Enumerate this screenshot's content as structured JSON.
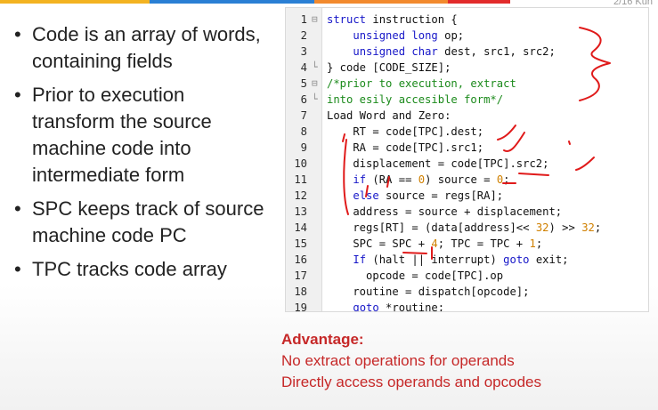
{
  "colors": {
    "bar_yellow": "#f3b321",
    "bar_blue": "#2a7fd4",
    "bar_orange": "#f28a2e",
    "bar_red": "#e22b2b",
    "keyword": "#1616c8",
    "comment": "#1b8a1b",
    "number": "#d08000",
    "advantage": "#c62828",
    "annotation": "#e01a1a"
  },
  "corner_text": "2/16 Kun",
  "bullets": [
    {
      "text": "Code is an array of words, containing fields"
    },
    {
      "text": "Prior to execution transform the source machine code into intermediate form"
    },
    {
      "text": "SPC keeps track of source machine code PC"
    },
    {
      "text": "TPC tracks code array"
    }
  ],
  "code": {
    "lines": [
      {
        "num": "1",
        "fold": "⊟",
        "text": "struct instruction {"
      },
      {
        "num": "2",
        "fold": "",
        "text": "    unsigned long op;"
      },
      {
        "num": "3",
        "fold": "",
        "text": "    unsigned char dest, src1, src2;"
      },
      {
        "num": "4",
        "fold": "└",
        "text": "} code [CODE_SIZE];"
      },
      {
        "num": "5",
        "fold": "⊟",
        "text": "/*prior to execution, extract"
      },
      {
        "num": "6",
        "fold": "└",
        "text": "into esily accesible form*/"
      },
      {
        "num": "7",
        "fold": "",
        "text": "Load Word and Zero:"
      },
      {
        "num": "8",
        "fold": "",
        "text": "    RT = code[TPC].dest;"
      },
      {
        "num": "9",
        "fold": "",
        "text": "    RA = code[TPC].src1;"
      },
      {
        "num": "10",
        "fold": "",
        "text": "    displacement = code[TPC].src2;"
      },
      {
        "num": "11",
        "fold": "",
        "text": "    if (RA == 0) source = 0;"
      },
      {
        "num": "12",
        "fold": "",
        "text": "    else source = regs[RA];"
      },
      {
        "num": "13",
        "fold": "",
        "text": "    address = source + displacement;"
      },
      {
        "num": "14",
        "fold": "",
        "text": "    regs[RT] = (data[address]<< 32) >> 32;"
      },
      {
        "num": "15",
        "fold": "",
        "text": "    SPC = SPC + 4; TPC = TPC + 1;"
      },
      {
        "num": "16",
        "fold": "",
        "text": "    If (halt || interrupt) goto exit;"
      },
      {
        "num": "17",
        "fold": "",
        "text": "      opcode = code[TPC].op"
      },
      {
        "num": "18",
        "fold": "",
        "text": "    routine = dispatch[opcode];"
      },
      {
        "num": "19",
        "fold": "",
        "text": "    goto *routine;"
      }
    ],
    "keywords": [
      "struct",
      "unsigned",
      "long",
      "char",
      "if",
      "else",
      "goto",
      "If"
    ]
  },
  "advantage": {
    "title": "Advantage:",
    "lines": [
      "No extract operations for operands",
      "Directly access operands and opcodes"
    ]
  }
}
